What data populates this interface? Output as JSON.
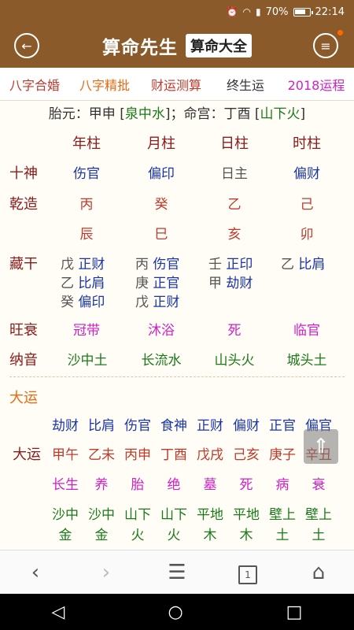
{
  "statusbar": {
    "icons": [
      "alarm-icon",
      "wifi-icon",
      "signal-icon"
    ],
    "battery": "70%",
    "battery_level": 0.7,
    "time": "22:14"
  },
  "header": {
    "back_icon": "back-arrow-icon",
    "title": "算命先生",
    "tag": "算命大全",
    "menu_icon": "menu-icon"
  },
  "nav_tabs": [
    {
      "label": "八字合婚",
      "color": "#c0392b"
    },
    {
      "label": "八字精批",
      "color": "#e86a10"
    },
    {
      "label": "财运测算",
      "color": "#c0392b"
    },
    {
      "label": "终生运",
      "color": "#333333"
    },
    {
      "label": "2018运程",
      "color": "#d020c8"
    }
  ],
  "taiyuan": {
    "prefix": "胎元：甲申 [",
    "nayin1": "泉中水",
    "mid": "]；命宫：丁酉 [",
    "nayin2": "山下火",
    "suffix": "]"
  },
  "pillars": {
    "headers": [
      "年柱",
      "月柱",
      "日柱",
      "时柱"
    ],
    "shishen": {
      "label": "十神",
      "values": [
        "伤官",
        "偏印",
        "日主",
        "偏财"
      ]
    },
    "qianzao": {
      "label": "乾造",
      "stems": [
        "丙",
        "癸",
        "乙",
        "己"
      ],
      "branches": [
        "辰",
        "巳",
        "亥",
        "卯"
      ]
    },
    "canggan": {
      "label": "藏干",
      "columns": [
        [
          {
            "gan": "戊",
            "god": "正财"
          },
          {
            "gan": "乙",
            "god": "比肩"
          },
          {
            "gan": "癸",
            "god": "偏印"
          }
        ],
        [
          {
            "gan": "丙",
            "god": "伤官"
          },
          {
            "gan": "庚",
            "god": "正官"
          },
          {
            "gan": "戊",
            "god": "正财"
          }
        ],
        [
          {
            "gan": "壬",
            "god": "正印"
          },
          {
            "gan": "甲",
            "god": "劫财"
          }
        ],
        [
          {
            "gan": "乙",
            "god": "比肩"
          }
        ]
      ]
    },
    "wangshuai": {
      "label": "旺衰",
      "values": [
        "冠带",
        "沐浴",
        "死",
        "临官"
      ]
    },
    "nayin": {
      "label": "纳音",
      "values": [
        "沙中土",
        "长流水",
        "山头火",
        "城头土"
      ]
    }
  },
  "dayun": {
    "section_title": "大运",
    "label": "大运",
    "gods": [
      "劫财",
      "比肩",
      "伤官",
      "食神",
      "正财",
      "偏财",
      "正官",
      "偏官"
    ],
    "ganzhi": [
      "甲午",
      "乙未",
      "丙申",
      "丁酉",
      "戊戌",
      "己亥",
      "庚子",
      "辛丑"
    ],
    "states": [
      "长生",
      "养",
      "胎",
      "绝",
      "墓",
      "死",
      "病",
      "衰"
    ],
    "nayin_top": [
      "沙中",
      "沙中",
      "山下",
      "山下",
      "平地",
      "平地",
      "壁上",
      "壁上"
    ],
    "nayin_bottom": [
      "金",
      "金",
      "火",
      "火",
      "木",
      "木",
      "土",
      "土"
    ]
  },
  "floating": {
    "scroll_top_icon": "arrow-up-icon"
  },
  "browser": {
    "back_icon": "chevron-left-icon",
    "forward_icon": "chevron-right-icon",
    "menu_icon": "hamburger-icon",
    "tabs_count": "1",
    "home_icon": "home-icon"
  },
  "android_nav": {
    "back": "◁",
    "home": "○",
    "recent": "□"
  }
}
